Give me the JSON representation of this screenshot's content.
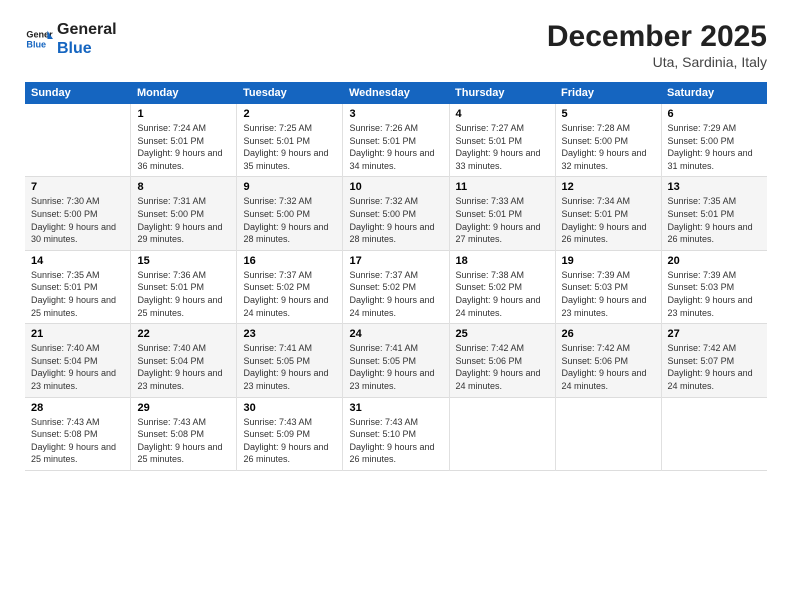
{
  "logo": {
    "line1": "General",
    "line2": "Blue"
  },
  "title": "December 2025",
  "location": "Uta, Sardinia, Italy",
  "days_header": [
    "Sunday",
    "Monday",
    "Tuesday",
    "Wednesday",
    "Thursday",
    "Friday",
    "Saturday"
  ],
  "weeks": [
    [
      {
        "num": "",
        "sunrise": "",
        "sunset": "",
        "daylight": ""
      },
      {
        "num": "1",
        "sunrise": "Sunrise: 7:24 AM",
        "sunset": "Sunset: 5:01 PM",
        "daylight": "Daylight: 9 hours and 36 minutes."
      },
      {
        "num": "2",
        "sunrise": "Sunrise: 7:25 AM",
        "sunset": "Sunset: 5:01 PM",
        "daylight": "Daylight: 9 hours and 35 minutes."
      },
      {
        "num": "3",
        "sunrise": "Sunrise: 7:26 AM",
        "sunset": "Sunset: 5:01 PM",
        "daylight": "Daylight: 9 hours and 34 minutes."
      },
      {
        "num": "4",
        "sunrise": "Sunrise: 7:27 AM",
        "sunset": "Sunset: 5:01 PM",
        "daylight": "Daylight: 9 hours and 33 minutes."
      },
      {
        "num": "5",
        "sunrise": "Sunrise: 7:28 AM",
        "sunset": "Sunset: 5:00 PM",
        "daylight": "Daylight: 9 hours and 32 minutes."
      },
      {
        "num": "6",
        "sunrise": "Sunrise: 7:29 AM",
        "sunset": "Sunset: 5:00 PM",
        "daylight": "Daylight: 9 hours and 31 minutes."
      }
    ],
    [
      {
        "num": "7",
        "sunrise": "Sunrise: 7:30 AM",
        "sunset": "Sunset: 5:00 PM",
        "daylight": "Daylight: 9 hours and 30 minutes."
      },
      {
        "num": "8",
        "sunrise": "Sunrise: 7:31 AM",
        "sunset": "Sunset: 5:00 PM",
        "daylight": "Daylight: 9 hours and 29 minutes."
      },
      {
        "num": "9",
        "sunrise": "Sunrise: 7:32 AM",
        "sunset": "Sunset: 5:00 PM",
        "daylight": "Daylight: 9 hours and 28 minutes."
      },
      {
        "num": "10",
        "sunrise": "Sunrise: 7:32 AM",
        "sunset": "Sunset: 5:00 PM",
        "daylight": "Daylight: 9 hours and 28 minutes."
      },
      {
        "num": "11",
        "sunrise": "Sunrise: 7:33 AM",
        "sunset": "Sunset: 5:01 PM",
        "daylight": "Daylight: 9 hours and 27 minutes."
      },
      {
        "num": "12",
        "sunrise": "Sunrise: 7:34 AM",
        "sunset": "Sunset: 5:01 PM",
        "daylight": "Daylight: 9 hours and 26 minutes."
      },
      {
        "num": "13",
        "sunrise": "Sunrise: 7:35 AM",
        "sunset": "Sunset: 5:01 PM",
        "daylight": "Daylight: 9 hours and 26 minutes."
      }
    ],
    [
      {
        "num": "14",
        "sunrise": "Sunrise: 7:35 AM",
        "sunset": "Sunset: 5:01 PM",
        "daylight": "Daylight: 9 hours and 25 minutes."
      },
      {
        "num": "15",
        "sunrise": "Sunrise: 7:36 AM",
        "sunset": "Sunset: 5:01 PM",
        "daylight": "Daylight: 9 hours and 25 minutes."
      },
      {
        "num": "16",
        "sunrise": "Sunrise: 7:37 AM",
        "sunset": "Sunset: 5:02 PM",
        "daylight": "Daylight: 9 hours and 24 minutes."
      },
      {
        "num": "17",
        "sunrise": "Sunrise: 7:37 AM",
        "sunset": "Sunset: 5:02 PM",
        "daylight": "Daylight: 9 hours and 24 minutes."
      },
      {
        "num": "18",
        "sunrise": "Sunrise: 7:38 AM",
        "sunset": "Sunset: 5:02 PM",
        "daylight": "Daylight: 9 hours and 24 minutes."
      },
      {
        "num": "19",
        "sunrise": "Sunrise: 7:39 AM",
        "sunset": "Sunset: 5:03 PM",
        "daylight": "Daylight: 9 hours and 23 minutes."
      },
      {
        "num": "20",
        "sunrise": "Sunrise: 7:39 AM",
        "sunset": "Sunset: 5:03 PM",
        "daylight": "Daylight: 9 hours and 23 minutes."
      }
    ],
    [
      {
        "num": "21",
        "sunrise": "Sunrise: 7:40 AM",
        "sunset": "Sunset: 5:04 PM",
        "daylight": "Daylight: 9 hours and 23 minutes."
      },
      {
        "num": "22",
        "sunrise": "Sunrise: 7:40 AM",
        "sunset": "Sunset: 5:04 PM",
        "daylight": "Daylight: 9 hours and 23 minutes."
      },
      {
        "num": "23",
        "sunrise": "Sunrise: 7:41 AM",
        "sunset": "Sunset: 5:05 PM",
        "daylight": "Daylight: 9 hours and 23 minutes."
      },
      {
        "num": "24",
        "sunrise": "Sunrise: 7:41 AM",
        "sunset": "Sunset: 5:05 PM",
        "daylight": "Daylight: 9 hours and 23 minutes."
      },
      {
        "num": "25",
        "sunrise": "Sunrise: 7:42 AM",
        "sunset": "Sunset: 5:06 PM",
        "daylight": "Daylight: 9 hours and 24 minutes."
      },
      {
        "num": "26",
        "sunrise": "Sunrise: 7:42 AM",
        "sunset": "Sunset: 5:06 PM",
        "daylight": "Daylight: 9 hours and 24 minutes."
      },
      {
        "num": "27",
        "sunrise": "Sunrise: 7:42 AM",
        "sunset": "Sunset: 5:07 PM",
        "daylight": "Daylight: 9 hours and 24 minutes."
      }
    ],
    [
      {
        "num": "28",
        "sunrise": "Sunrise: 7:43 AM",
        "sunset": "Sunset: 5:08 PM",
        "daylight": "Daylight: 9 hours and 25 minutes."
      },
      {
        "num": "29",
        "sunrise": "Sunrise: 7:43 AM",
        "sunset": "Sunset: 5:08 PM",
        "daylight": "Daylight: 9 hours and 25 minutes."
      },
      {
        "num": "30",
        "sunrise": "Sunrise: 7:43 AM",
        "sunset": "Sunset: 5:09 PM",
        "daylight": "Daylight: 9 hours and 26 minutes."
      },
      {
        "num": "31",
        "sunrise": "Sunrise: 7:43 AM",
        "sunset": "Sunset: 5:10 PM",
        "daylight": "Daylight: 9 hours and 26 minutes."
      },
      {
        "num": "",
        "sunrise": "",
        "sunset": "",
        "daylight": ""
      },
      {
        "num": "",
        "sunrise": "",
        "sunset": "",
        "daylight": ""
      },
      {
        "num": "",
        "sunrise": "",
        "sunset": "",
        "daylight": ""
      }
    ]
  ]
}
